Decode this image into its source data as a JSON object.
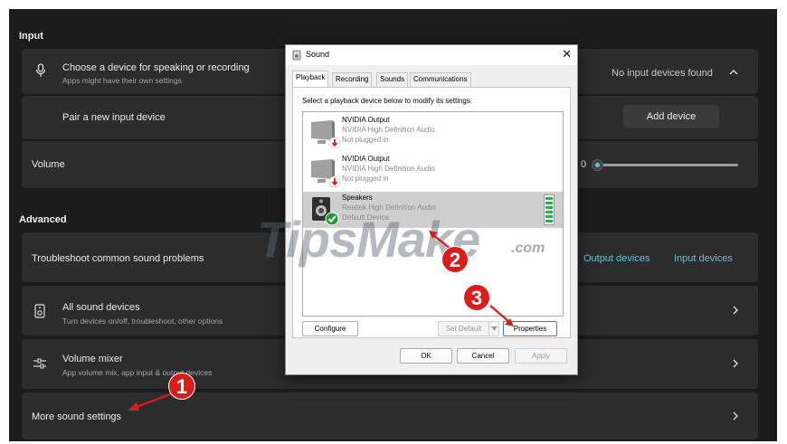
{
  "settings": {
    "input_section": "Input",
    "choose_device_title": "Choose a device for speaking or recording",
    "choose_device_sub": "Apps might have their own settings",
    "no_input_devices": "No input devices found",
    "pair_input": "Pair a new input device",
    "add_device": "Add device",
    "volume_label": "Volume",
    "volume_value": "0",
    "volume_level": 0,
    "advanced_section": "Advanced",
    "troubleshoot": "Troubleshoot common sound problems",
    "output_devices": "Output devices",
    "input_devices": "Input devices",
    "all_sound_title": "All sound devices",
    "all_sound_sub": "Turn devices on/off, troubleshoot, other options",
    "volume_mixer_title": "Volume mixer",
    "volume_mixer_sub": "App volume mix, app input & output devices",
    "more_sound": "More sound settings",
    "accent_color": "#5cc6dc"
  },
  "dialog": {
    "title": "Sound",
    "tabs": [
      "Playback",
      "Recording",
      "Sounds",
      "Communications"
    ],
    "active_tab": "Playback",
    "instruction": "Select a playback device below to modify its settings:",
    "devices": [
      {
        "name": "NVIDIA Output",
        "driver": "NVIDIA High Definition Audio",
        "status": "Not plugged in",
        "icon": "monitor-unplugged-icon"
      },
      {
        "name": "NVIDIA Output",
        "driver": "NVIDIA High Definition Audio",
        "status": "Not plugged in",
        "icon": "monitor-unplugged-icon"
      },
      {
        "name": "Speakers",
        "driver": "Realtek High Definition Audio",
        "status": "Default Device",
        "icon": "speaker-default-icon",
        "selected": true
      }
    ],
    "configure": "Configure",
    "set_default": "Set Default",
    "properties": "Properties",
    "ok": "OK",
    "cancel": "Cancel",
    "apply": "Apply"
  },
  "watermark": {
    "main": "TipsMake",
    "suffix": ".com"
  },
  "annotations": [
    "1",
    "2",
    "3"
  ],
  "annotation_color": "#d91d1d"
}
